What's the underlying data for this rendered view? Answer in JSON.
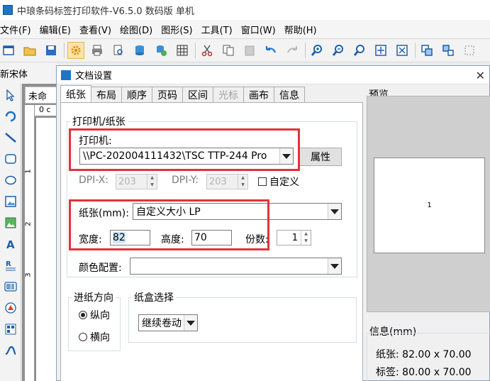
{
  "app": {
    "title": "中琅条码标签打印软件-V6.5.0 数码版 单机"
  },
  "menu": [
    "文件(F)",
    "编辑(E)",
    "查看(V)",
    "绘图(D)",
    "图形(S)",
    "工具(T)",
    "窗口(W)",
    "帮助(H)"
  ],
  "font_name": "新宋体",
  "document": {
    "tab_label": "未命",
    "ruler_h_label": "0 c",
    "ruler_v_marks": [
      "1",
      "2",
      "3"
    ]
  },
  "dialog": {
    "title": "文档设置",
    "close": "✕",
    "tabs": [
      "纸张",
      "布局",
      "顺序",
      "页码",
      "区间",
      "光标",
      "画布",
      "信息"
    ],
    "active_tab": 0,
    "disabled_tab": 5,
    "printer_group": {
      "legend": "打印机/纸张",
      "printer_label": "打印机:",
      "printer_value": "\\\\PC-202004111432\\TSC TTP-244 Pro",
      "properties_button": "属性",
      "dpi_x_label": "DPI-X:",
      "dpi_x_value": "203",
      "dpi_y_label": "DPI-Y:",
      "dpi_y_value": "203",
      "custom_label": "自定义",
      "paper_label": "纸张(mm):",
      "paper_value": "自定义大小 LP",
      "width_label": "宽度:",
      "width_value": "82",
      "height_label": "高度:",
      "height_value": "70",
      "copies_label": "份数:",
      "copies_value": "1",
      "color_label": "颜色配置:",
      "color_value": ""
    },
    "feed_group": {
      "legend": "进纸方向",
      "portrait": "纵向",
      "landscape": "横向",
      "selected": "portrait"
    },
    "tray_group": {
      "legend": "纸盒选择",
      "value": "继续卷动"
    },
    "preview": {
      "title": "预览",
      "paper_text": "1"
    },
    "info": {
      "title": "信息(mm)",
      "paper": "纸张: 82.00 x 70.00",
      "label": "标签: 80.00 x 70.00"
    }
  },
  "colors": {
    "highlight_box": "#e2333a",
    "accent": "#1d75c9"
  }
}
